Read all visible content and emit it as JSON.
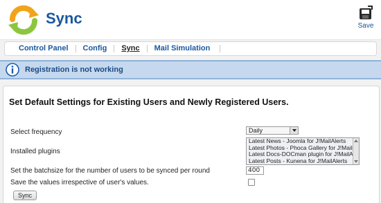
{
  "header": {
    "title": "Sync",
    "save_label": "Save"
  },
  "submenu": {
    "items": [
      {
        "label": "Control Panel"
      },
      {
        "label": "Config"
      },
      {
        "label": "Sync"
      },
      {
        "label": "Mail Simulation"
      }
    ],
    "active": "Sync"
  },
  "message": {
    "text": "Registration is not working"
  },
  "form": {
    "heading": "Set Default Settings for Existing Users and Newly Registered Users.",
    "frequency_label": "Select frequency",
    "frequency_value": "Daily",
    "plugins_label": "Installed plugins",
    "plugins": [
      "Latest News - Joomla for J!MailAlerts",
      "Latest Photos - Phoca Gallery for J!MailAlerts",
      "Latest Docs-DOCman plugin for J!MailAlerts",
      "Latest Posts - Kunena for J!MailAlerts"
    ],
    "batchsize_label": "Set the batchsize for the number of users to be synced per round",
    "batchsize_value": "400",
    "save_values_label": "Save the values irrespective of user's values.",
    "save_values_checked": false,
    "sync_button_label": "Sync"
  }
}
